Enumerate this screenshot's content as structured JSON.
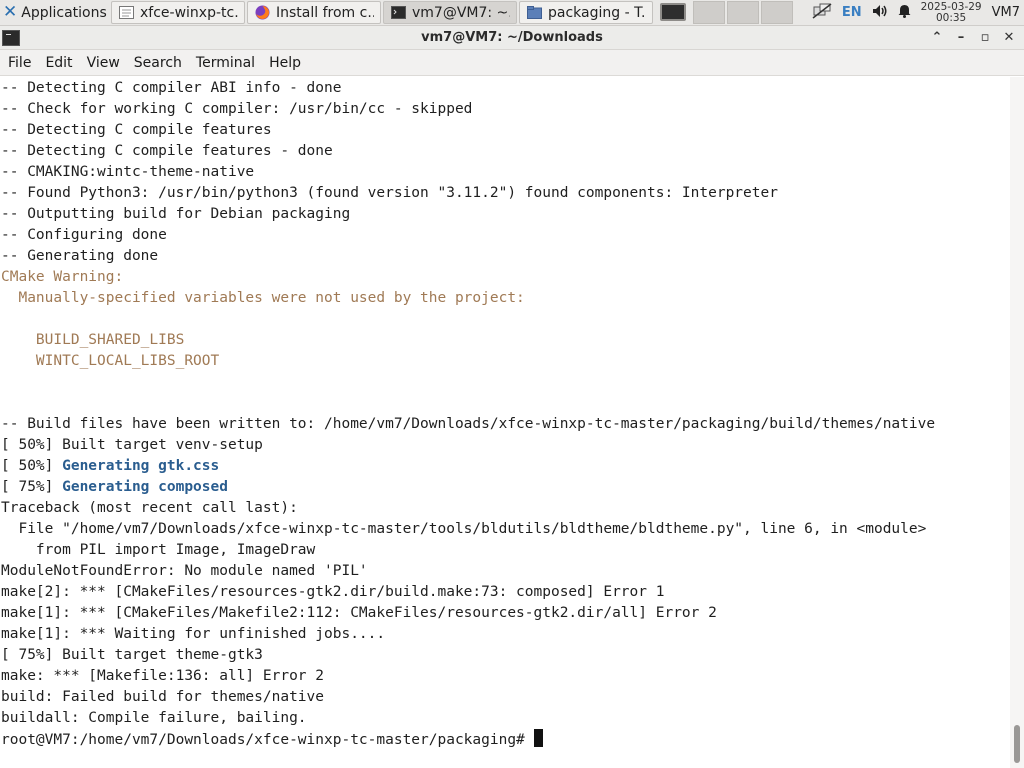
{
  "panel": {
    "apps_label": "Applications",
    "tasks": [
      {
        "label": "xfce-winxp-tc...",
        "icon": "document-icon"
      },
      {
        "label": "Install from c...",
        "icon": "firefox-icon"
      },
      {
        "label": "vm7@VM7: ~...",
        "icon": "terminal-icon"
      },
      {
        "label": "packaging - T...",
        "icon": "folder-icon"
      }
    ],
    "tray": {
      "language": "EN",
      "date": "2025-03-29",
      "time": "00:35",
      "user": "VM7"
    }
  },
  "window": {
    "title": "vm7@VM7: ~/Downloads"
  },
  "menubar": {
    "items": [
      "File",
      "Edit",
      "View",
      "Search",
      "Terminal",
      "Help"
    ]
  },
  "terminal": {
    "lines": [
      {
        "text": "-- Detecting C compiler ABI info - done",
        "style": ""
      },
      {
        "text": "-- Check for working C compiler: /usr/bin/cc - skipped",
        "style": ""
      },
      {
        "text": "-- Detecting C compile features",
        "style": ""
      },
      {
        "text": "-- Detecting C compile features - done",
        "style": ""
      },
      {
        "text": "-- CMAKING:wintc-theme-native",
        "style": ""
      },
      {
        "text": "-- Found Python3: /usr/bin/python3 (found version \"3.11.2\") found components: Interpreter",
        "style": ""
      },
      {
        "text": "-- Outputting build for Debian packaging",
        "style": ""
      },
      {
        "text": "-- Configuring done",
        "style": ""
      },
      {
        "text": "-- Generating done",
        "style": ""
      },
      {
        "text": "CMake Warning:",
        "style": "warn"
      },
      {
        "text": "  Manually-specified variables were not used by the project:",
        "style": "warn"
      },
      {
        "text": "",
        "style": ""
      },
      {
        "text": "    BUILD_SHARED_LIBS",
        "style": "warn"
      },
      {
        "text": "    WINTC_LOCAL_LIBS_ROOT",
        "style": "warn"
      },
      {
        "text": "",
        "style": ""
      },
      {
        "text": "",
        "style": ""
      },
      {
        "text": "-- Build files have been written to: /home/vm7/Downloads/xfce-winxp-tc-master/packaging/build/themes/native",
        "style": ""
      },
      {
        "text": "[ 50%] Built target venv-setup",
        "style": ""
      },
      {
        "text": "[ 50%] ",
        "style": "",
        "highlight": "Generating gtk.css"
      },
      {
        "text": "[ 75%] ",
        "style": "",
        "highlight": "Generating composed"
      },
      {
        "text": "Traceback (most recent call last):",
        "style": ""
      },
      {
        "text": "  File \"/home/vm7/Downloads/xfce-winxp-tc-master/tools/bldutils/bldtheme/bldtheme.py\", line 6, in <module>",
        "style": ""
      },
      {
        "text": "    from PIL import Image, ImageDraw",
        "style": ""
      },
      {
        "text": "ModuleNotFoundError: No module named 'PIL'",
        "style": ""
      },
      {
        "text": "make[2]: *** [CMakeFiles/resources-gtk2.dir/build.make:73: composed] Error 1",
        "style": ""
      },
      {
        "text": "make[1]: *** [CMakeFiles/Makefile2:112: CMakeFiles/resources-gtk2.dir/all] Error 2",
        "style": ""
      },
      {
        "text": "make[1]: *** Waiting for unfinished jobs....",
        "style": ""
      },
      {
        "text": "[ 75%] Built target theme-gtk3",
        "style": ""
      },
      {
        "text": "make: *** [Makefile:136: all] Error 2",
        "style": ""
      },
      {
        "text": "build: Failed build for themes/native",
        "style": ""
      },
      {
        "text": "buildall: Compile failure, bailing.",
        "style": ""
      }
    ],
    "prompt": "root@VM7:/home/vm7/Downloads/xfce-winxp-tc-master/packaging#"
  }
}
